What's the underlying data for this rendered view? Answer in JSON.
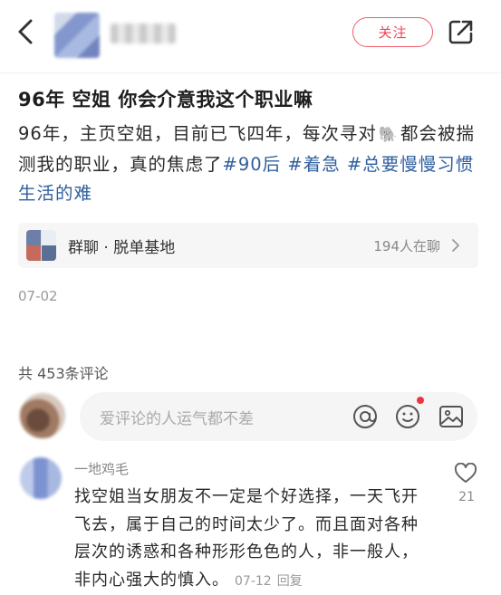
{
  "header": {
    "follow_label": "关注"
  },
  "post": {
    "title": "96年 空姐 你会介意我这个职业嘛",
    "body_part1": "96年，主页空姐，目前已飞四年，每次寻对",
    "body_emoji": "🐘",
    "body_part2": "都会被揣测我的职业，真的焦虑了",
    "tags": [
      "#90后",
      "#着急",
      "#总要慢慢习惯生活的难"
    ],
    "group": {
      "name": "群聊 · 脱单基地",
      "count": "194人在聊"
    },
    "date": "07-02"
  },
  "comments_section": {
    "count_label": "共 453条评论",
    "input_placeholder": "爱评论的人运气都不差",
    "comments": [
      {
        "author": "一地鸡毛",
        "text": "找空姐当女朋友不一定是个好选择，一天飞开飞去，属于自己的时间太少了。而且面对各种层次的诱惑和各种形形色色的人，非一般人，非内心强大的慎入。",
        "date": "07-12",
        "reply_label": "回复",
        "likes": "21"
      }
    ]
  },
  "colors": {
    "accent": "#ee4455",
    "tag": "#2f5f9e"
  }
}
